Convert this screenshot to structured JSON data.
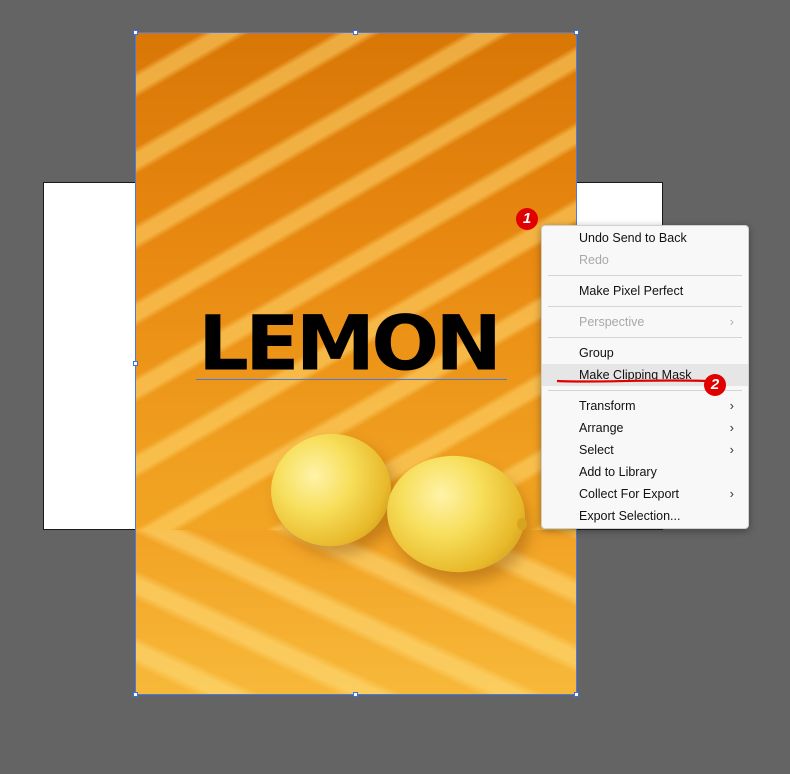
{
  "canvas": {
    "title_text": "LEMON"
  },
  "markers": {
    "step1": "1",
    "step2": "2"
  },
  "context_menu": {
    "items": [
      {
        "label": "Undo Send to Back",
        "enabled": true,
        "submenu": false
      },
      {
        "label": "Redo",
        "enabled": false,
        "submenu": false
      },
      {
        "label": "Make Pixel Perfect",
        "enabled": true,
        "submenu": false
      },
      {
        "label": "Perspective",
        "enabled": false,
        "submenu": true
      },
      {
        "label": "Group",
        "enabled": true,
        "submenu": false
      },
      {
        "label": "Make Clipping Mask",
        "enabled": true,
        "submenu": false,
        "highlighted": true
      },
      {
        "label": "Transform",
        "enabled": true,
        "submenu": true
      },
      {
        "label": "Arrange",
        "enabled": true,
        "submenu": true
      },
      {
        "label": "Select",
        "enabled": true,
        "submenu": true
      },
      {
        "label": "Add to Library",
        "enabled": true,
        "submenu": false
      },
      {
        "label": "Collect For Export",
        "enabled": true,
        "submenu": true
      },
      {
        "label": "Export Selection...",
        "enabled": true,
        "submenu": false
      }
    ],
    "submenu_arrow": "›"
  },
  "colors": {
    "pasteboard": "#646464",
    "selection": "#4a79e0",
    "annotation_red": "#e00000",
    "photo_orange": "#e98a12"
  },
  "icons": {
    "submenu_arrow": "chevron-right-icon"
  }
}
